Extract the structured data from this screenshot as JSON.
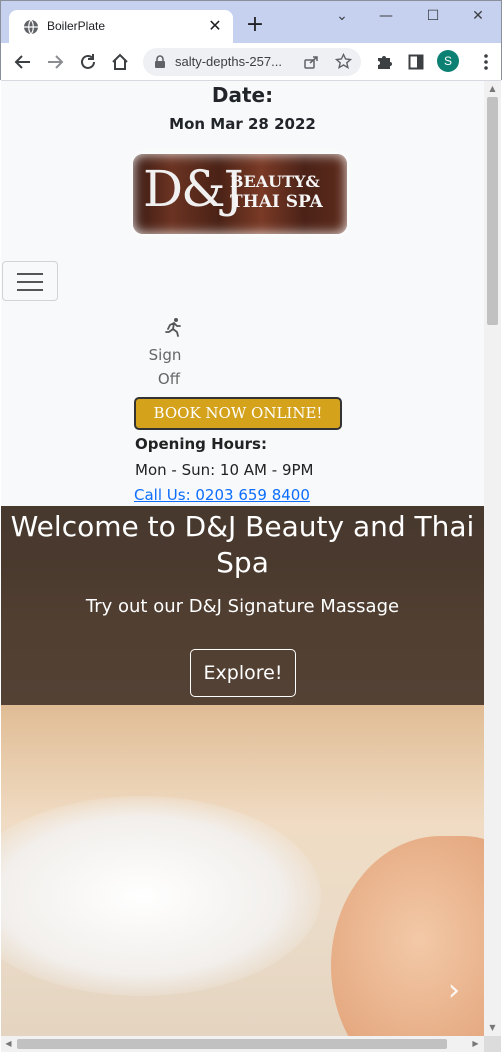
{
  "browser": {
    "tab_title": "BoilerPlate",
    "tab_close": "✕",
    "new_tab": "+",
    "url": "salty-depths-257...",
    "profile_initial": "S",
    "window_controls": {
      "collapse": "⌄",
      "minimize": "—",
      "maximize": "☐",
      "close": "✕"
    }
  },
  "header": {
    "date_label": "Date:",
    "date_value": "Mon Mar 28 2022"
  },
  "logo": {
    "mark": "D&J",
    "line1": "BEAUTY&",
    "line2": "THAI SPA"
  },
  "nav": {
    "sign_off_line1": "Sign",
    "sign_off_line2": "Off"
  },
  "booking": {
    "book_button": "BOOK NOW ONLINE!",
    "hours_label": "Opening Hours:",
    "hours_value": "Mon - Sun: 10 AM - 9PM",
    "phone_link": "Call Us: 0203 659 8400"
  },
  "hero": {
    "title": "Welcome to D&J Beauty and Thai Spa",
    "subtitle": "Try out our D&J Signature Massage",
    "cta": "Explore!",
    "next_glyph": "›"
  },
  "colors": {
    "book_button_bg": "#d4a21b",
    "link": "#0d6efd",
    "profile_avatar": "#0b8073",
    "chrome_bg": "#c6d0ef"
  }
}
